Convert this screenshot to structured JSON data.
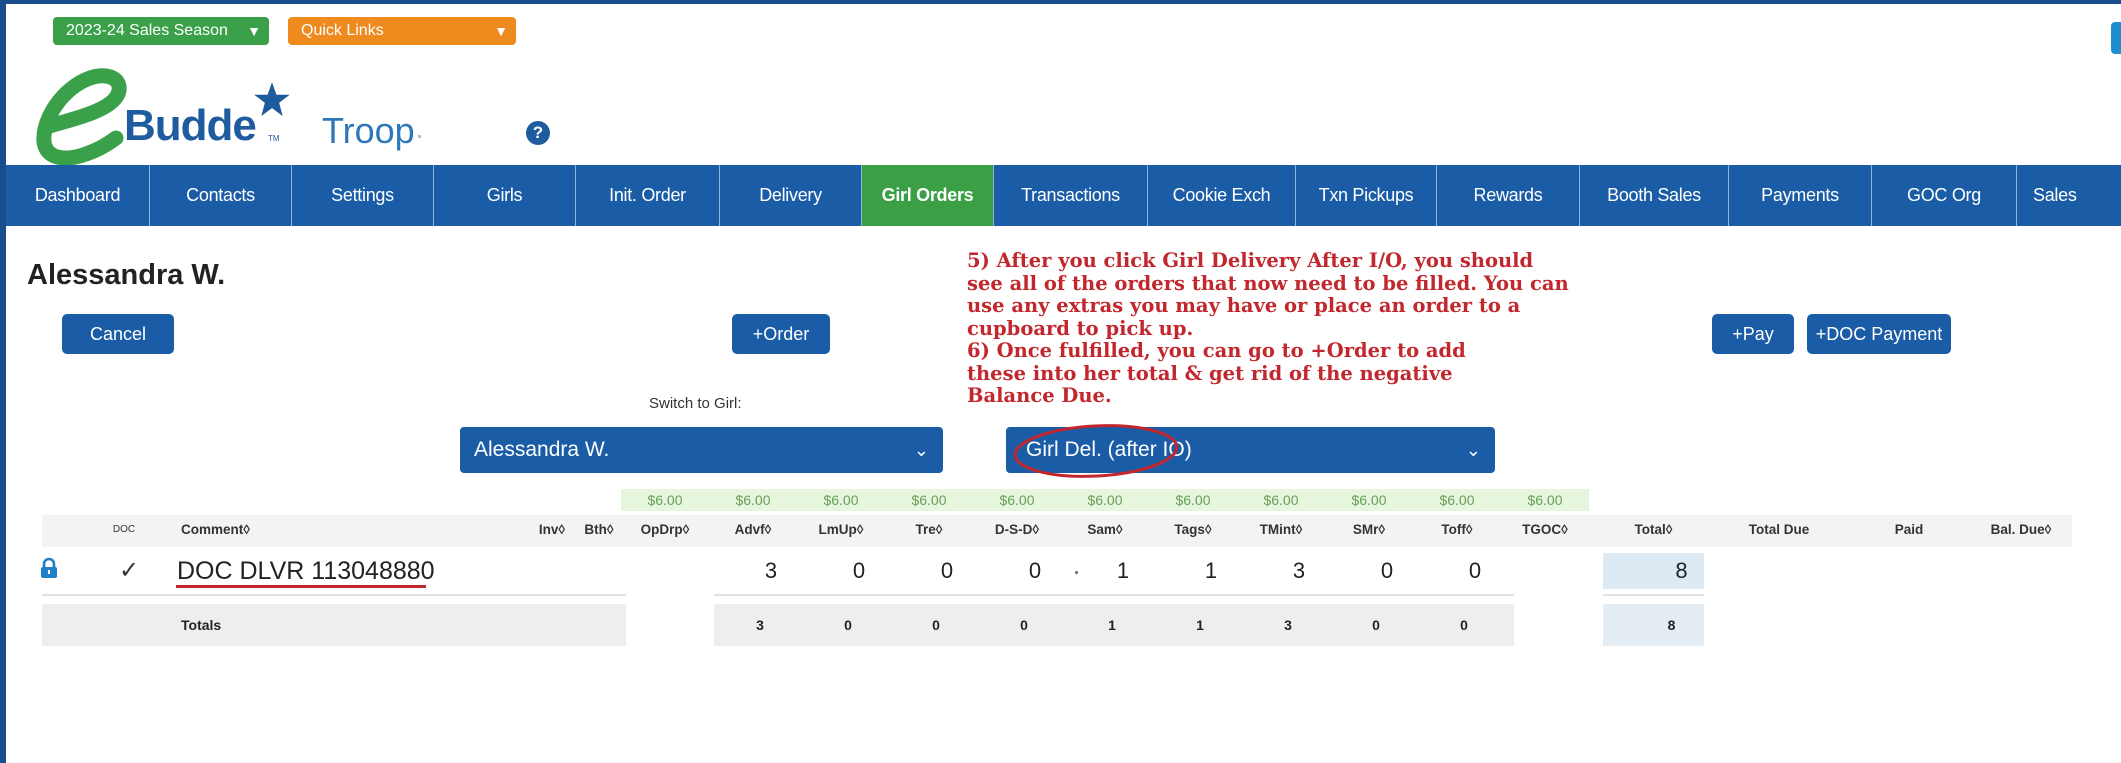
{
  "header": {
    "season_label": "2023-24 Sales Season",
    "quick_links_label": "Quick Links",
    "logo_text": "Budde",
    "logo_tm": "TM",
    "troop_label": "Troop",
    "help_glyph": "?"
  },
  "nav": {
    "tabs": [
      {
        "label": "Dashboard",
        "active": false
      },
      {
        "label": "Contacts",
        "active": false
      },
      {
        "label": "Settings",
        "active": false
      },
      {
        "label": "Girls",
        "active": false
      },
      {
        "label": "Init. Order",
        "active": false
      },
      {
        "label": "Delivery",
        "active": false
      },
      {
        "label": "Girl Orders",
        "active": true
      },
      {
        "label": "Transactions",
        "active": false
      },
      {
        "label": "Cookie Exch",
        "active": false
      },
      {
        "label": "Txn Pickups",
        "active": false
      },
      {
        "label": "Rewards",
        "active": false
      },
      {
        "label": "Booth Sales",
        "active": false
      },
      {
        "label": "Payments",
        "active": false
      },
      {
        "label": "GOC Org",
        "active": false
      },
      {
        "label": "Sales",
        "active": false
      }
    ]
  },
  "page": {
    "girl_name": "Alessandra W.",
    "cancel_label": "Cancel",
    "order_label": "+Order",
    "pay_label": "+Pay",
    "doc_payment_label": "+DOC Payment",
    "switch_label": "Switch to Girl:",
    "girl_select_value": "Alessandra W.",
    "type_select_value": "Girl Del. (after IO)"
  },
  "annotation": {
    "lines": [
      "5) After you click Girl Delivery After I/O, you should",
      "see all of the orders that now need to be filled. You can",
      "use any extras you may have or place an order to a",
      "cupboard to pick up.",
      "6) Once fulfilled, you can go to +Order to add",
      "these into her total & get rid of the negative",
      "Balance Due."
    ]
  },
  "table": {
    "prices": [
      "$6.00",
      "$6.00",
      "$6.00",
      "$6.00",
      "$6.00",
      "$6.00",
      "$6.00",
      "$6.00",
      "$6.00",
      "$6.00",
      "$6.00"
    ],
    "headers": [
      "DOC",
      "Comment◊",
      "Inv◊",
      "Bth◊",
      "OpDrp◊",
      "Advf◊",
      "LmUp◊",
      "Tre◊",
      "D-S-D◊",
      "Sam◊",
      "Tags◊",
      "TMint◊",
      "SMr◊",
      "Toff◊",
      "TGOC◊",
      "Total◊",
      "Total Due",
      "Paid",
      "Bal. Due◊"
    ],
    "row": {
      "doc_check": "✓",
      "comment": "DOC DLVR 113048880",
      "values": [
        "3",
        "0",
        "0",
        "0",
        "1",
        "1",
        "3",
        "0",
        "0"
      ],
      "total": "8"
    },
    "totals": {
      "label": "Totals",
      "values": [
        "3",
        "0",
        "0",
        "0",
        "1",
        "1",
        "3",
        "0",
        "0"
      ],
      "total": "8"
    }
  },
  "colors": {
    "nav_blue": "#1a5da6",
    "active_green": "#3a9f45",
    "season_green": "#3aa14a",
    "quick_orange": "#ef8a1f",
    "annotation_red": "#c1272d",
    "price_bg": "#e6f5dd"
  }
}
